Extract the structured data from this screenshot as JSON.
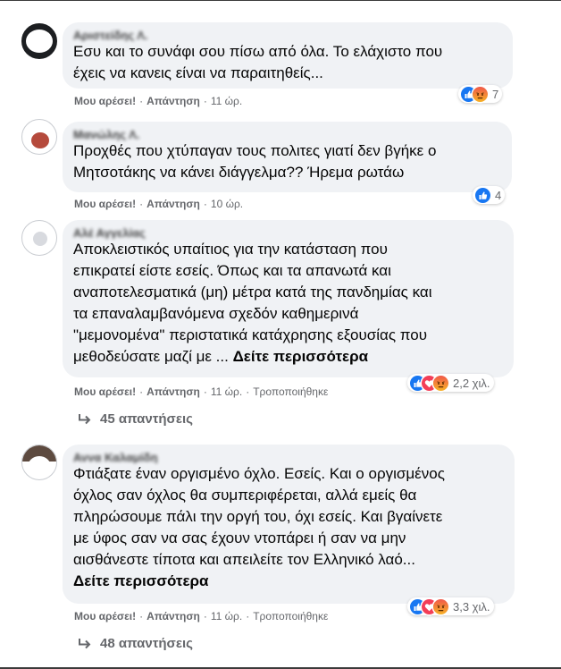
{
  "action_labels": {
    "like": "Μου αρέσει!",
    "reply": "Απάντηση",
    "edited": "Τροποποιήθηκε"
  },
  "comments": [
    {
      "author": "Αριστείδης Λ.",
      "lines": [
        "Εσυ και το συνάφι σου πίσω από όλα. Το ελάχιστο που",
        "έχεις να κανεις είναι να παραιτηθείς..."
      ],
      "time": "11 ώρ.",
      "reactions": [
        "like",
        "angry"
      ],
      "reaction_count": "7"
    },
    {
      "author": "Μανώλης Λ.",
      "lines": [
        "Προχθές που χτύπαγαν τους πολιτες γιατί δεν βγήκε ο",
        "Μητσοτάκης να κάνει διάγγελμα?? Ήρεμα ρωτάω"
      ],
      "time": "10 ώρ.",
      "reactions": [
        "like"
      ],
      "reaction_count": "4"
    },
    {
      "author": "Αλέ Αγγελίας",
      "lines": [
        "Αποκλειστικός υπαίτιος για την κατάσταση που",
        "επικρατεί είστε εσείς. Όπως και τα απανωτά και",
        "αναποτελεσματικά (μη) μέτρα κατά της πανδημίας και",
        "τα επαναλαμβανόμενα σχεδόν καθημερινά",
        "\"μεμονομένα\" περιστατικά κατάχρησης εξουσίας που",
        "μεθοδεύσατε μαζί με ..."
      ],
      "see_more": "Δείτε περισσότερα",
      "time": "11 ώρ.",
      "edited": true,
      "reactions": [
        "like",
        "love",
        "angry"
      ],
      "reaction_count": "2,2 χιλ.",
      "replies_label": "45 απαντήσεις"
    },
    {
      "author": "Αννα Καλαμίδη",
      "lines": [
        "Φτιάξατε έναν οργισμένο όχλο. Εσείς. Και ο οργισμένος",
        "όχλος σαν όχλος θα συμπεριφέρεται, αλλά εμείς θα",
        "πληρώσουμε πάλι την οργή του, όχι εσείς. Και βγαίνετε",
        "με ύφος σαν να σας έχουν ντοπάρει ή σαν να μην",
        "αισθάνεστε τίποτα και απειλείτε τον Ελληνικό λαό..."
      ],
      "see_more": "Δείτε περισσότερα",
      "time": "11 ώρ.",
      "edited": true,
      "reactions": [
        "like",
        "love",
        "angry"
      ],
      "reaction_count": "3,3 χιλ.",
      "replies_label": "48 απαντήσεις"
    }
  ],
  "colors": {
    "bubble": "#f0f2f5",
    "secondary_text": "#65676b",
    "like": "#1877f2",
    "love": "#f33e58",
    "angry": "#e9710f"
  },
  "icons": {
    "like": "thumbs-up-icon",
    "love": "heart-icon",
    "angry": "angry-face-icon",
    "reply_arrow": "reply-arrow-icon"
  }
}
